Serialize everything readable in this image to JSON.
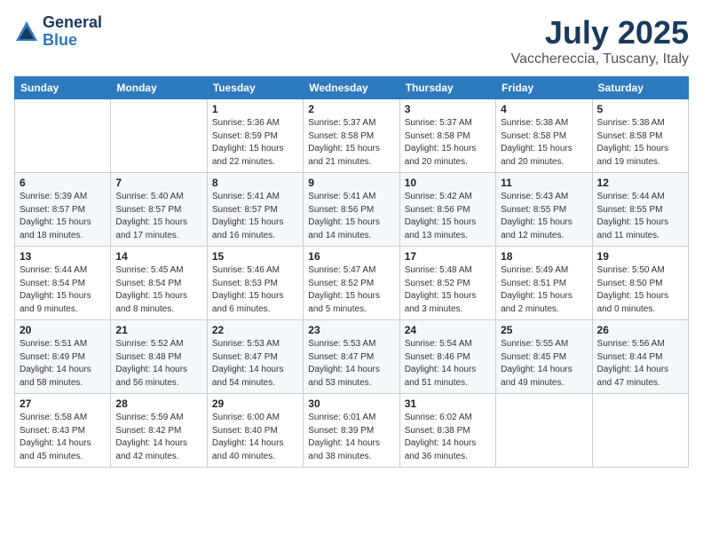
{
  "header": {
    "logo_general": "General",
    "logo_blue": "Blue",
    "month_title": "July 2025",
    "location": "Vacchereccia, Tuscany, Italy"
  },
  "weekdays": [
    "Sunday",
    "Monday",
    "Tuesday",
    "Wednesday",
    "Thursday",
    "Friday",
    "Saturday"
  ],
  "weeks": [
    [
      {
        "day": "",
        "info": ""
      },
      {
        "day": "",
        "info": ""
      },
      {
        "day": "1",
        "info": "Sunrise: 5:36 AM\nSunset: 8:59 PM\nDaylight: 15 hours\nand 22 minutes."
      },
      {
        "day": "2",
        "info": "Sunrise: 5:37 AM\nSunset: 8:58 PM\nDaylight: 15 hours\nand 21 minutes."
      },
      {
        "day": "3",
        "info": "Sunrise: 5:37 AM\nSunset: 8:58 PM\nDaylight: 15 hours\nand 20 minutes."
      },
      {
        "day": "4",
        "info": "Sunrise: 5:38 AM\nSunset: 8:58 PM\nDaylight: 15 hours\nand 20 minutes."
      },
      {
        "day": "5",
        "info": "Sunrise: 5:38 AM\nSunset: 8:58 PM\nDaylight: 15 hours\nand 19 minutes."
      }
    ],
    [
      {
        "day": "6",
        "info": "Sunrise: 5:39 AM\nSunset: 8:57 PM\nDaylight: 15 hours\nand 18 minutes."
      },
      {
        "day": "7",
        "info": "Sunrise: 5:40 AM\nSunset: 8:57 PM\nDaylight: 15 hours\nand 17 minutes."
      },
      {
        "day": "8",
        "info": "Sunrise: 5:41 AM\nSunset: 8:57 PM\nDaylight: 15 hours\nand 16 minutes."
      },
      {
        "day": "9",
        "info": "Sunrise: 5:41 AM\nSunset: 8:56 PM\nDaylight: 15 hours\nand 14 minutes."
      },
      {
        "day": "10",
        "info": "Sunrise: 5:42 AM\nSunset: 8:56 PM\nDaylight: 15 hours\nand 13 minutes."
      },
      {
        "day": "11",
        "info": "Sunrise: 5:43 AM\nSunset: 8:55 PM\nDaylight: 15 hours\nand 12 minutes."
      },
      {
        "day": "12",
        "info": "Sunrise: 5:44 AM\nSunset: 8:55 PM\nDaylight: 15 hours\nand 11 minutes."
      }
    ],
    [
      {
        "day": "13",
        "info": "Sunrise: 5:44 AM\nSunset: 8:54 PM\nDaylight: 15 hours\nand 9 minutes."
      },
      {
        "day": "14",
        "info": "Sunrise: 5:45 AM\nSunset: 8:54 PM\nDaylight: 15 hours\nand 8 minutes."
      },
      {
        "day": "15",
        "info": "Sunrise: 5:46 AM\nSunset: 8:53 PM\nDaylight: 15 hours\nand 6 minutes."
      },
      {
        "day": "16",
        "info": "Sunrise: 5:47 AM\nSunset: 8:52 PM\nDaylight: 15 hours\nand 5 minutes."
      },
      {
        "day": "17",
        "info": "Sunrise: 5:48 AM\nSunset: 8:52 PM\nDaylight: 15 hours\nand 3 minutes."
      },
      {
        "day": "18",
        "info": "Sunrise: 5:49 AM\nSunset: 8:51 PM\nDaylight: 15 hours\nand 2 minutes."
      },
      {
        "day": "19",
        "info": "Sunrise: 5:50 AM\nSunset: 8:50 PM\nDaylight: 15 hours\nand 0 minutes."
      }
    ],
    [
      {
        "day": "20",
        "info": "Sunrise: 5:51 AM\nSunset: 8:49 PM\nDaylight: 14 hours\nand 58 minutes."
      },
      {
        "day": "21",
        "info": "Sunrise: 5:52 AM\nSunset: 8:48 PM\nDaylight: 14 hours\nand 56 minutes."
      },
      {
        "day": "22",
        "info": "Sunrise: 5:53 AM\nSunset: 8:47 PM\nDaylight: 14 hours\nand 54 minutes."
      },
      {
        "day": "23",
        "info": "Sunrise: 5:53 AM\nSunset: 8:47 PM\nDaylight: 14 hours\nand 53 minutes."
      },
      {
        "day": "24",
        "info": "Sunrise: 5:54 AM\nSunset: 8:46 PM\nDaylight: 14 hours\nand 51 minutes."
      },
      {
        "day": "25",
        "info": "Sunrise: 5:55 AM\nSunset: 8:45 PM\nDaylight: 14 hours\nand 49 minutes."
      },
      {
        "day": "26",
        "info": "Sunrise: 5:56 AM\nSunset: 8:44 PM\nDaylight: 14 hours\nand 47 minutes."
      }
    ],
    [
      {
        "day": "27",
        "info": "Sunrise: 5:58 AM\nSunset: 8:43 PM\nDaylight: 14 hours\nand 45 minutes."
      },
      {
        "day": "28",
        "info": "Sunrise: 5:59 AM\nSunset: 8:42 PM\nDaylight: 14 hours\nand 42 minutes."
      },
      {
        "day": "29",
        "info": "Sunrise: 6:00 AM\nSunset: 8:40 PM\nDaylight: 14 hours\nand 40 minutes."
      },
      {
        "day": "30",
        "info": "Sunrise: 6:01 AM\nSunset: 8:39 PM\nDaylight: 14 hours\nand 38 minutes."
      },
      {
        "day": "31",
        "info": "Sunrise: 6:02 AM\nSunset: 8:38 PM\nDaylight: 14 hours\nand 36 minutes."
      },
      {
        "day": "",
        "info": ""
      },
      {
        "day": "",
        "info": ""
      }
    ]
  ]
}
